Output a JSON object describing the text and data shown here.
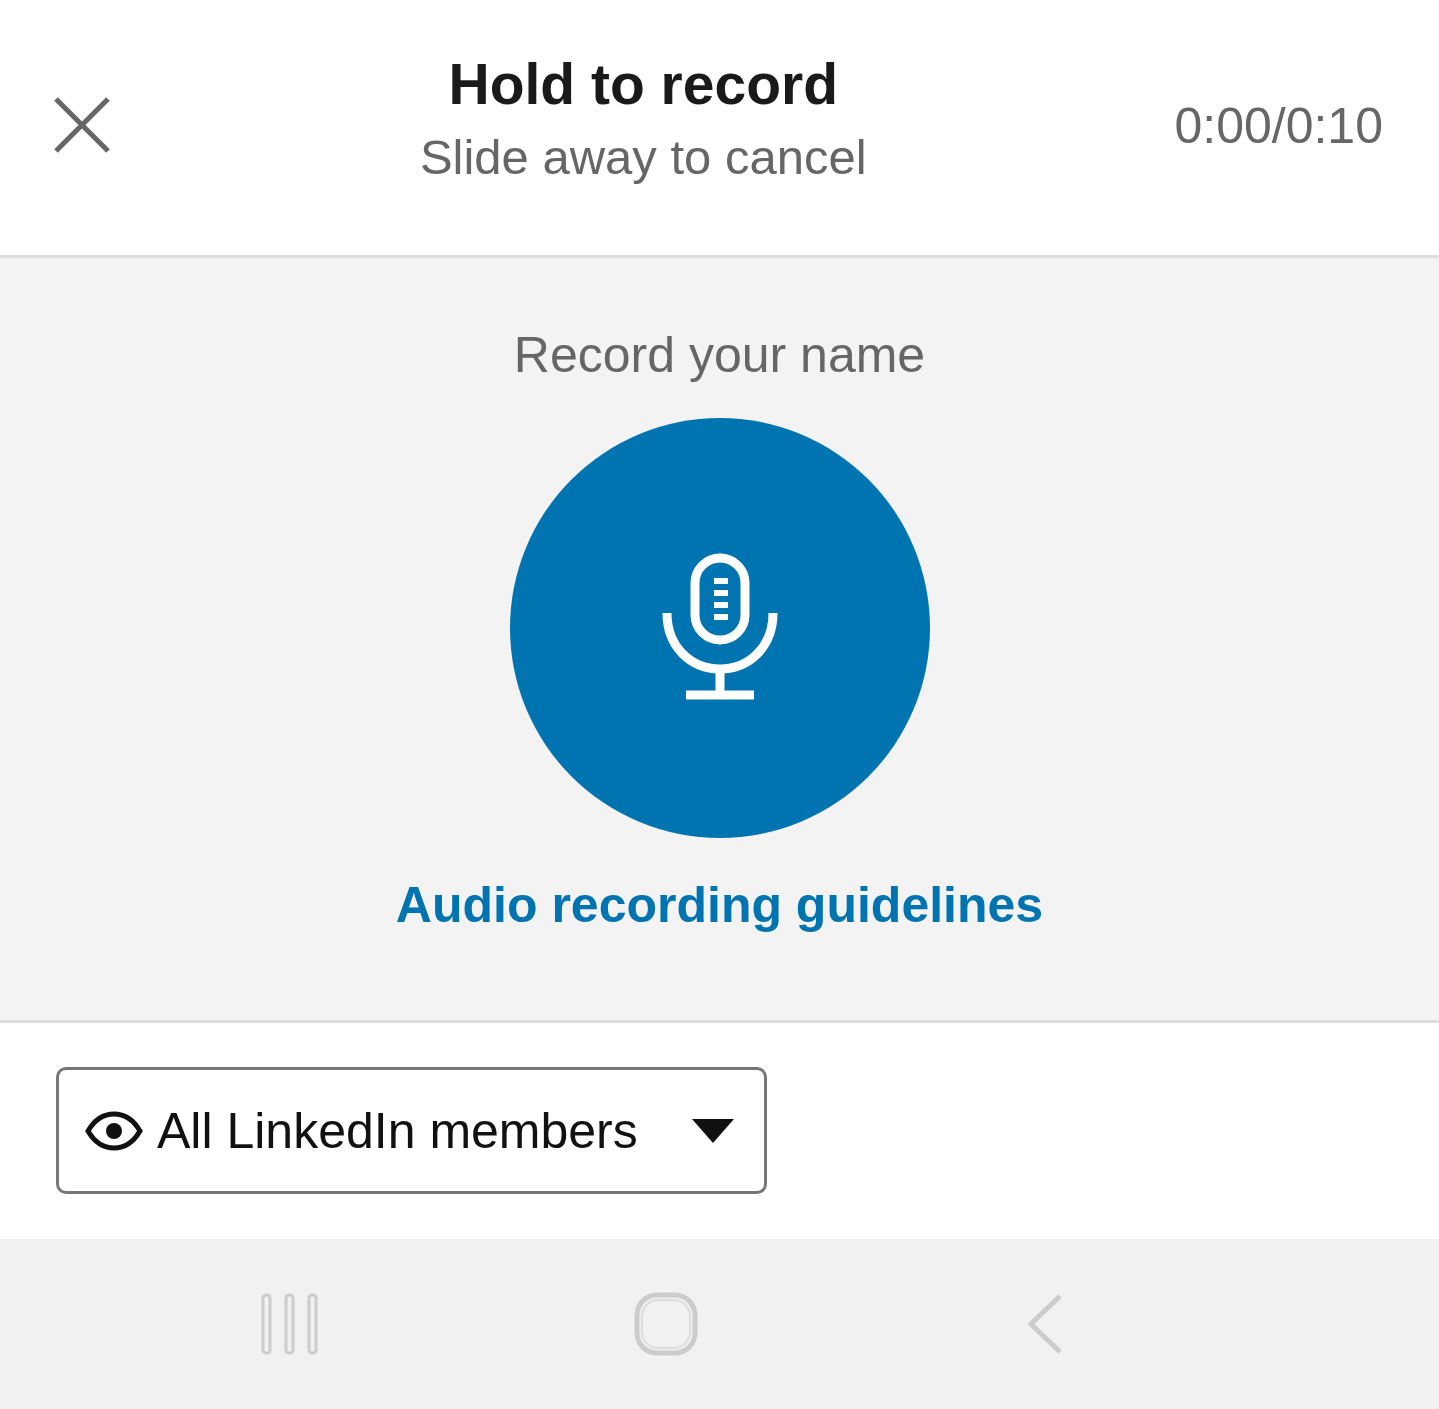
{
  "header": {
    "title": "Hold to record",
    "subtitle": "Slide away to cancel",
    "timer": "0:00/0:10"
  },
  "recorder": {
    "prompt": "Record your name",
    "link": "Audio recording guidelines"
  },
  "visibility": {
    "label": "All LinkedIn members"
  }
}
